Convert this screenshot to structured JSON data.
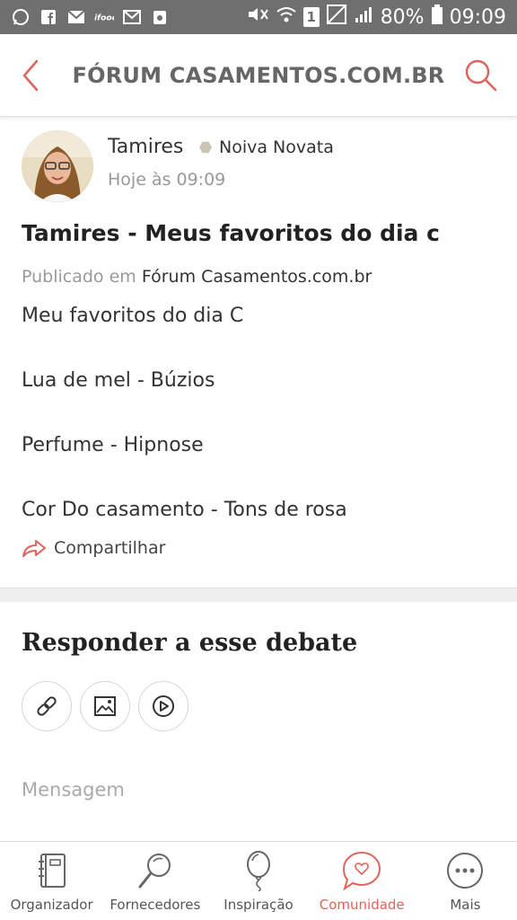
{
  "status_bar": {
    "battery": "80%",
    "time": "09:09",
    "sim": "1"
  },
  "header": {
    "title": "FÓRUM CASAMENTOS.COM.BR"
  },
  "post": {
    "author": "Tamires",
    "badge": "Noiva Novata",
    "time": "Hoje às 09:09",
    "title": "Tamires - Meus favoritos do dia c",
    "published_prefix": "Publicado em",
    "forum": "Fórum Casamentos.com.br",
    "lines": [
      "Meu favoritos do dia C",
      "Lua de mel - Búzios",
      "Perfume - Hipnose",
      "Cor Do casamento - Tons de rosa"
    ],
    "share_label": "Compartilhar"
  },
  "reply": {
    "title": "Responder a esse debate",
    "message_placeholder": "Mensagem"
  },
  "bottom_nav": {
    "items": [
      {
        "label": "Organizador",
        "icon": "notebook-icon"
      },
      {
        "label": "Fornecedores",
        "icon": "magnifier-icon"
      },
      {
        "label": "Inspiração",
        "icon": "balloon-icon"
      },
      {
        "label": "Comunidade",
        "icon": "chat-heart-icon"
      },
      {
        "label": "Mais",
        "icon": "more-icon"
      }
    ],
    "active": "Comunidade"
  },
  "colors": {
    "accent": "#e0635c",
    "status_bar": "#6f6f6f",
    "divider": "#efefef"
  }
}
